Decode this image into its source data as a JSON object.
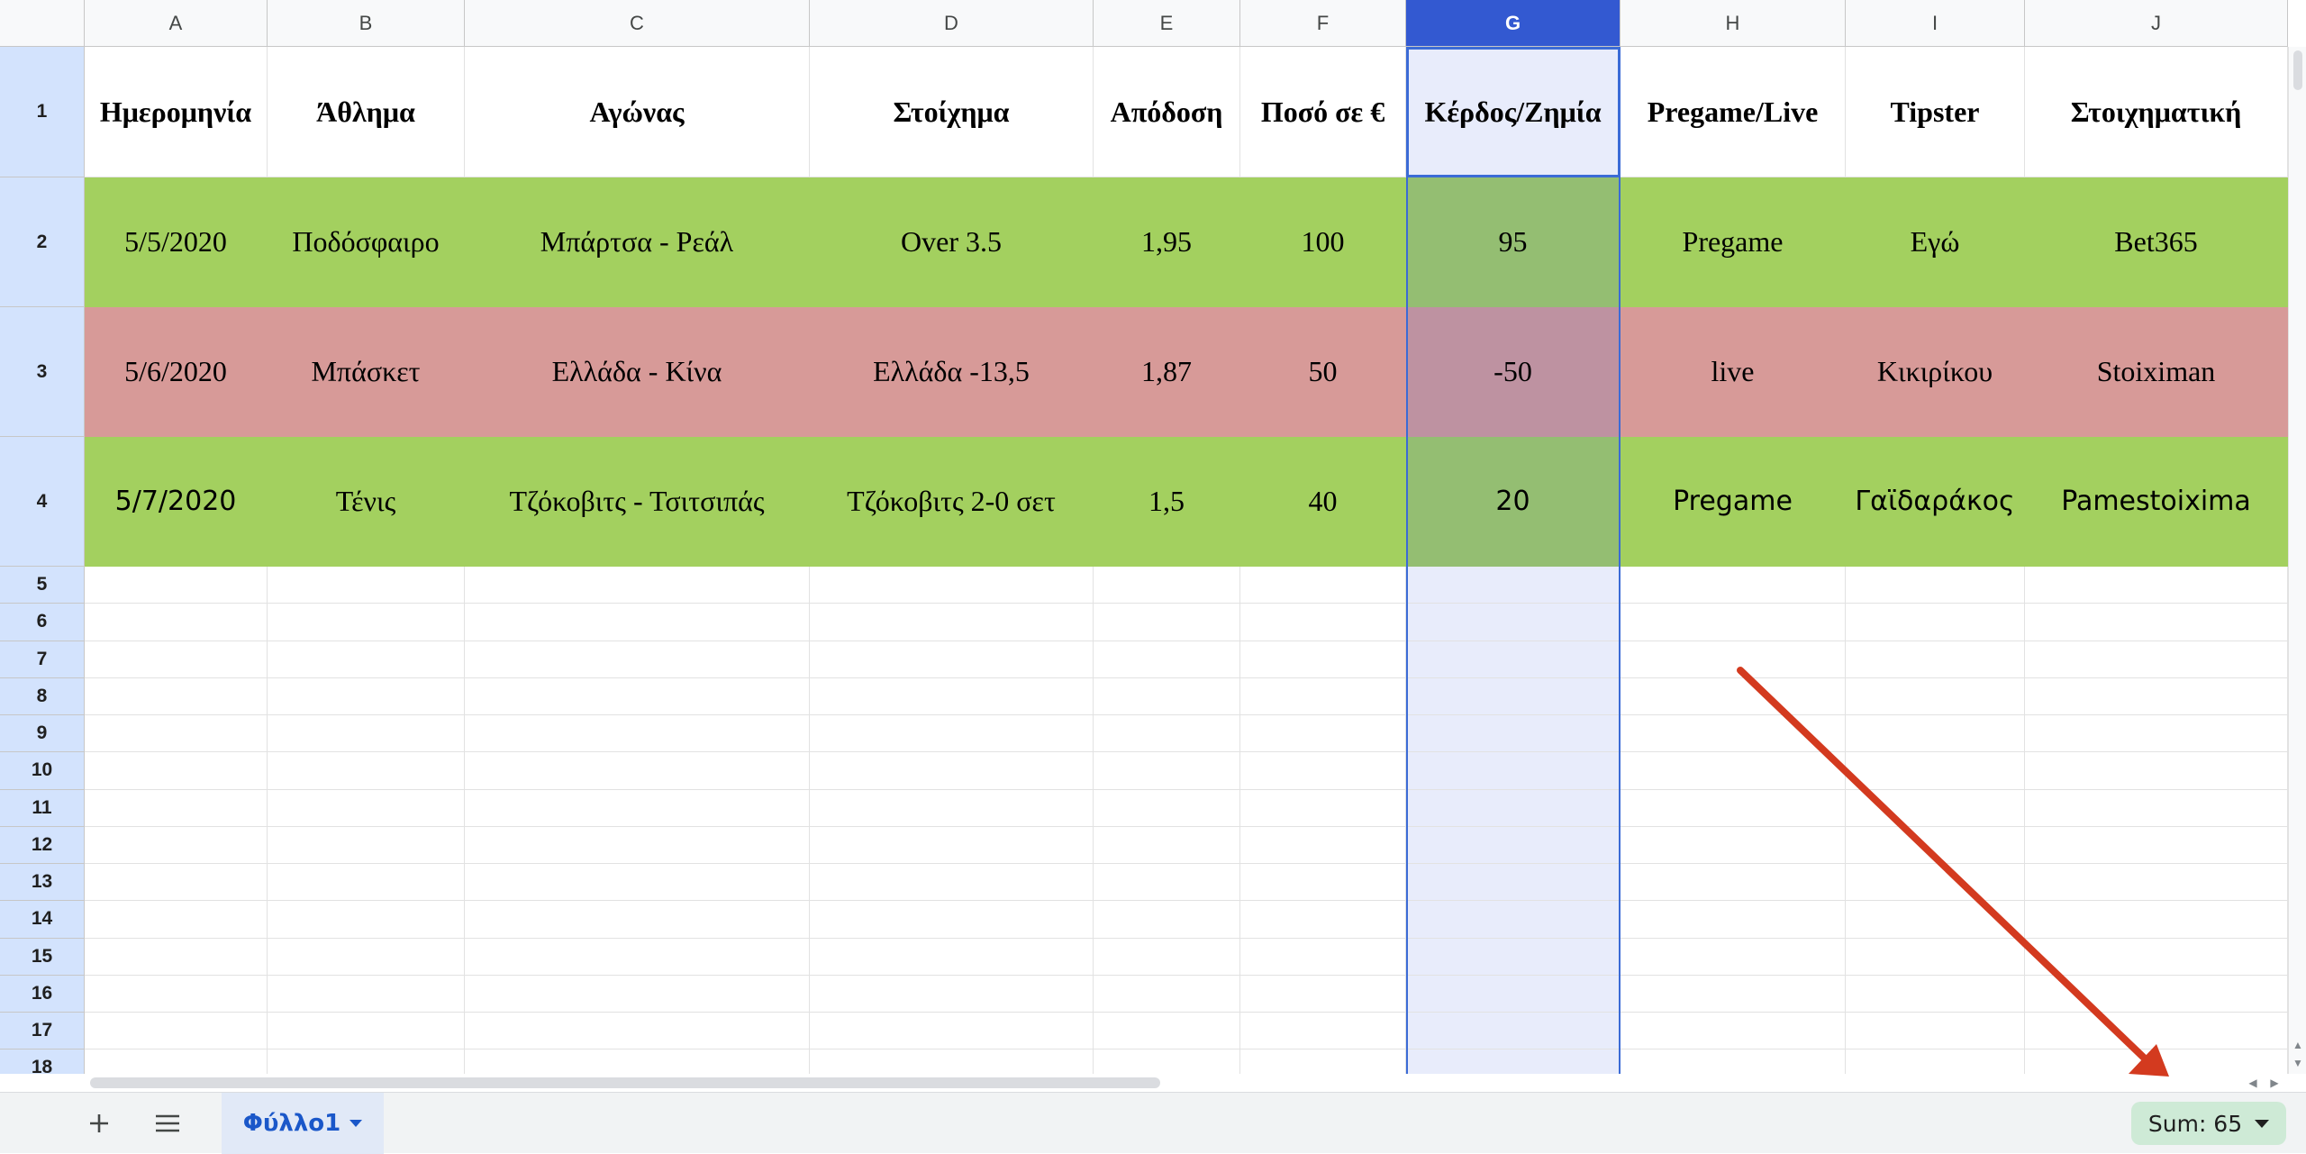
{
  "columns": [
    "A",
    "B",
    "C",
    "D",
    "E",
    "F",
    "G",
    "H",
    "I",
    "J"
  ],
  "selected_column": "G",
  "header_row": [
    "Ημερομηνία",
    "Άθλημα",
    "Αγώνας",
    "Στοίχημα",
    "Απόδοση",
    "Ποσό σε €",
    "Κέρδος/Ζημία",
    "Pregame/Live",
    "Tipster",
    "Στοιχηματική"
  ],
  "rows": [
    {
      "cells": [
        "5/5/2020",
        "Ποδόσφαιρο",
        "Μπάρτσα - Ρεάλ",
        "Over 3.5",
        "1,95",
        "100",
        "95",
        "Pregame",
        "Εγώ",
        "Bet365"
      ],
      "fill": "#a3d05f"
    },
    {
      "cells": [
        "5/6/2020",
        "Μπάσκετ",
        "Ελλάδα - Κίνα",
        "Ελλάδα -13,5",
        "1,87",
        "50",
        "-50",
        "live",
        "Κικιρίκου",
        "Stoiximan"
      ],
      "fill": "#d79a98"
    },
    {
      "cells": [
        "5/7/2020",
        "Τένις",
        "Τζόκοβιτς - Τσιτσιπάς",
        "Τζόκοβιτς 2-0 σετ",
        "1,5",
        "40",
        "20",
        "Pregame",
        "Γαϊδαράκος",
        "Pamestoixima"
      ],
      "fill": "#a3d05f"
    }
  ],
  "row_numbers": [
    "1",
    "2",
    "3",
    "4",
    "5",
    "6",
    "7",
    "8",
    "9",
    "10",
    "11",
    "12",
    "13",
    "14",
    "15",
    "16",
    "17",
    "18"
  ],
  "colors": {
    "selected_column_header": "#3359d1",
    "selection_tint": "#e8ecfb",
    "annotation_arrow": "#d33a1f"
  },
  "bottom_bar": {
    "add_sheet_icon": "plus-icon",
    "all_sheets_icon": "menu-icon",
    "sheet_tab_label": "Φύλλο1",
    "sum_label": "Sum: 65"
  }
}
